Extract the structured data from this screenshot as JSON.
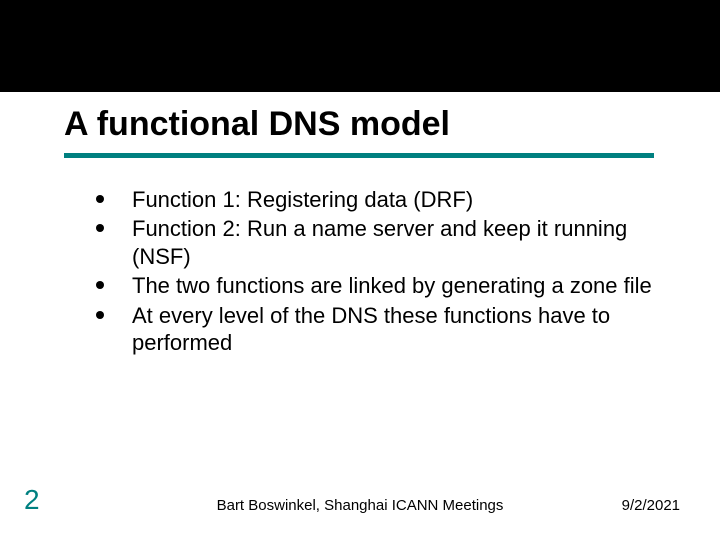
{
  "title": "A functional DNS model",
  "bullets": [
    "Function 1: Registering data (DRF)",
    "Function 2: Run a name server and keep it running (NSF)",
    "The two functions are linked by generating a zone file",
    "At every level of the DNS these functions have to performed"
  ],
  "page_number": "2",
  "footer_center": "Bart Boswinkel, Shanghai ICANN Meetings",
  "footer_date": "9/2/2021",
  "colors": {
    "accent": "#008080"
  }
}
